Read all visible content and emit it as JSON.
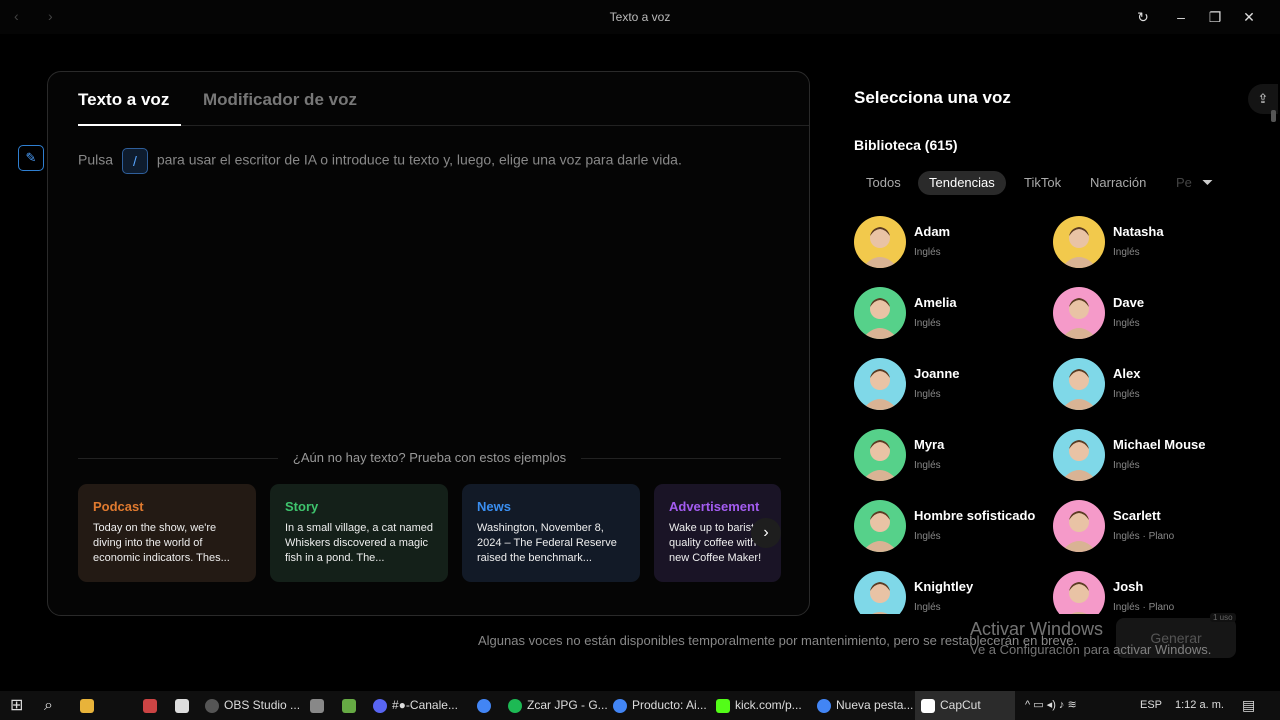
{
  "window": {
    "title": "Texto a voz",
    "nav_back": "‹",
    "nav_forward": "›",
    "refresh_icon": "↻",
    "minimize_icon": "–",
    "restore_icon": "❐",
    "close_icon": "✕"
  },
  "editor": {
    "tabs": [
      "Texto a voz",
      "Modificador de voz"
    ],
    "ai_icon": "✎",
    "prompt_before": "Pulsa",
    "prompt_key": "/",
    "prompt_after": "para usar el escritor de IA o introduce tu texto y, luego, elige una voz para darle vida.",
    "examples_label": "¿Aún no hay texto? Prueba con estos ejemplos",
    "next_icon": "›",
    "examples": [
      {
        "title": "Podcast",
        "body": "Today on the show, we're diving into the world of economic indicators. Thes...",
        "title_color": "#e07a2f",
        "bg": "#231a14"
      },
      {
        "title": "Story",
        "body": "In a small village, a cat named Whiskers discovered a magic fish in a pond. The...",
        "title_color": "#3ec46d",
        "bg": "#142019"
      },
      {
        "title": "News",
        "body": "Washington, November 8, 2024 – The Federal Reserve raised the benchmark...",
        "title_color": "#3a8ef0",
        "bg": "#121a27"
      },
      {
        "title": "Advertisement",
        "body": "Wake up to barista-quality coffee with the new Coffee Maker! With a...",
        "title_color": "#a35cf0",
        "bg": "#1a1426"
      }
    ]
  },
  "voices_panel": {
    "title": "Selecciona una voz",
    "library": "Biblioteca (615)",
    "filters": [
      "Todos",
      "Tendencias",
      "TikTok",
      "Narración",
      "Pe"
    ],
    "active_filter": "Tendencias",
    "filter_icon": "⏷",
    "upload_icon": "⇪",
    "voices": [
      {
        "name": "Adam",
        "lang": "Inglés",
        "color": "#f2c94c"
      },
      {
        "name": "Natasha",
        "lang": "Inglés",
        "color": "#f2c94c"
      },
      {
        "name": "Amelia",
        "lang": "Inglés",
        "color": "#56d18a"
      },
      {
        "name": "Dave",
        "lang": "Inglés",
        "color": "#f59ac9"
      },
      {
        "name": "Joanne",
        "lang": "Inglés",
        "color": "#7fd8e8"
      },
      {
        "name": "Alex",
        "lang": "Inglés",
        "color": "#7fd8e8"
      },
      {
        "name": "Myra",
        "lang": "Inglés",
        "color": "#56d18a"
      },
      {
        "name": "Michael Mouse",
        "lang": "Inglés",
        "color": "#7fd8e8"
      },
      {
        "name": "Hombre sofisticado",
        "lang": "Inglés",
        "color": "#56d18a"
      },
      {
        "name": "Scarlett",
        "lang": "Inglés · Plano",
        "color": "#f59ac9"
      },
      {
        "name": "Knightley",
        "lang": "Inglés",
        "color": "#7fd8e8"
      },
      {
        "name": "Josh",
        "lang": "Inglés · Plano",
        "color": "#f59ac9"
      }
    ]
  },
  "footer": {
    "notice": "Algunas voces no están disponibles temporalmente por mantenimiento, pero se restablecerán en breve.",
    "generate": "Generar",
    "generate_badge": "1 uso",
    "watermark_title": "Activar Windows",
    "watermark_sub": "Ve a Configuración para activar Windows."
  },
  "taskbar": {
    "start_icon": "⊞",
    "search_icon": "⌕",
    "items": [
      {
        "label": "OBS Studio ...",
        "color": "#444"
      },
      {
        "label": "#●-Canale...",
        "color": "#5865f2"
      },
      {
        "label": "Zcar JPG - G...",
        "color": "#1db954"
      },
      {
        "label": "Producto: Ai...",
        "color": "#4285f4"
      },
      {
        "label": "kick.com/p...",
        "color": "#53fc18"
      },
      {
        "label": "Nueva pesta...",
        "color": "#4285f4"
      },
      {
        "label": "CapCut",
        "color": "#ffffff"
      }
    ],
    "lang": "ESP",
    "time": "1:12 a. m."
  }
}
